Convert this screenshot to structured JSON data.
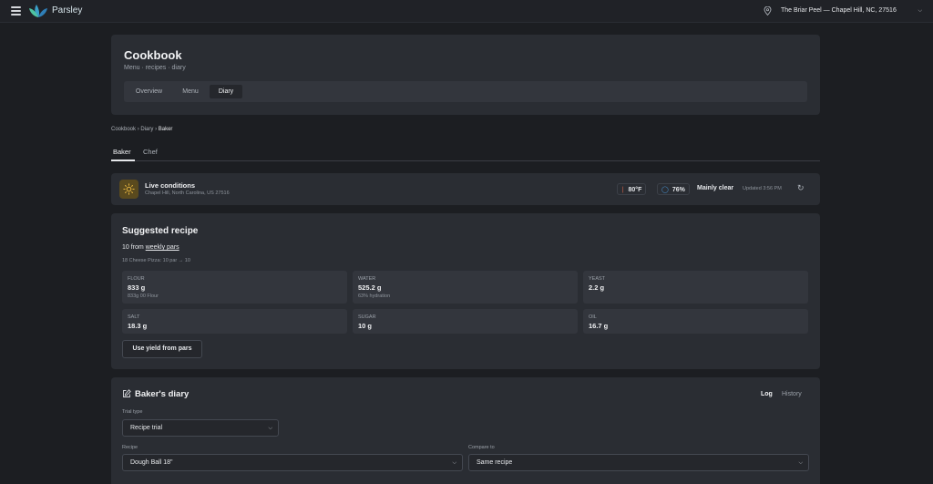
{
  "app": {
    "brand": "Parsley",
    "location": "The Briar Peel — Chapel Hill, NC, 27516",
    "accent": "#3aa0c8"
  },
  "header": {
    "title": "Cookbook",
    "subtitle": "Menu · recipes · diary",
    "tabs": [
      {
        "label": "Overview",
        "active": false
      },
      {
        "label": "Menu",
        "active": false
      },
      {
        "label": "Diary",
        "active": true
      }
    ]
  },
  "breadcrumb": {
    "items": [
      "Cookbook",
      "Diary"
    ],
    "current": "Baker",
    "separator": "›"
  },
  "subtabs": [
    {
      "label": "Baker",
      "active": true
    },
    {
      "label": "Chef",
      "active": false
    }
  ],
  "live": {
    "title": "Live conditions",
    "location": "Chapel Hill, North Carolina, US 27516",
    "temperature": "80°F",
    "humidity": "76%",
    "condition": "Mainly clear",
    "updated": "Updated 3:56 PM"
  },
  "suggested": {
    "title": "Suggested recipe",
    "from_prefix": "10 from",
    "from_link": "weekly pars",
    "note": "18 Cheese Pizza: 10 par → 10",
    "ingredients": [
      {
        "name": "Flour",
        "value": "833 g",
        "note": "833g 00 Flour"
      },
      {
        "name": "Water",
        "value": "525.2 g",
        "note": "63% hydration"
      },
      {
        "name": "Yeast",
        "value": "2.2 g",
        "note": ""
      },
      {
        "name": "Salt",
        "value": "18.3 g",
        "note": ""
      },
      {
        "name": "Sugar",
        "value": "10 g",
        "note": ""
      },
      {
        "name": "Oil",
        "value": "16.7 g",
        "note": ""
      }
    ],
    "yield_button": "Use yield from pars"
  },
  "diary": {
    "title": "Baker's diary",
    "tab_log": "Log",
    "tab_history": "History",
    "trial_type_label": "Trial type",
    "trial_type_value": "Recipe trial",
    "recipe_label": "Recipe",
    "recipe_value": "Dough Ball 18\"",
    "compare_label": "Compare to",
    "compare_value": "Same recipe"
  }
}
